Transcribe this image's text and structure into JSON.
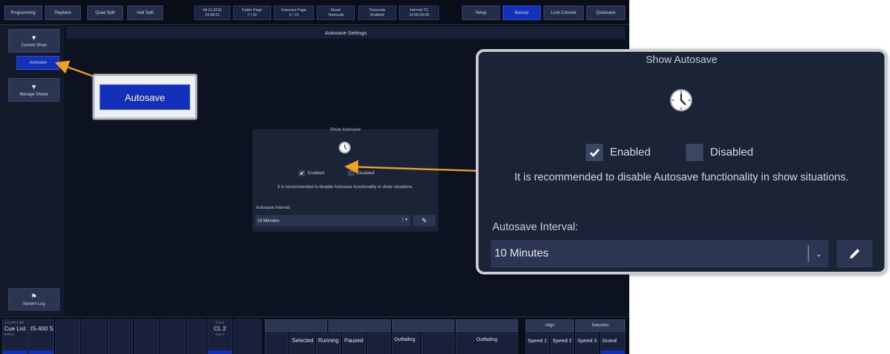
{
  "topbar": {
    "tabs": [
      "Programming",
      "Playback",
      "Quad Split",
      "Half Split"
    ],
    "datetime": {
      "date": "04.11.2016",
      "time": "19:48:21"
    },
    "fader_page": {
      "label": "Fader Page",
      "value": "7 / 10"
    },
    "executor_page": {
      "label": "Executor Page",
      "value": "2 / 10"
    },
    "reset_timecode": {
      "label": "Reset",
      "value": "Timecode"
    },
    "timecode": {
      "label": "Timecode",
      "value": "Enabled"
    },
    "internal_tc": {
      "label": "Internal TC",
      "value": "19:00:00:00"
    },
    "right_buttons": [
      "Setup",
      "Backup",
      "Lock Console",
      "Quicksave"
    ]
  },
  "sidebar": {
    "current_show": "Current Show",
    "autosave": "Autosave",
    "manage_shows": "Manage Shows",
    "system_log": "System Log"
  },
  "main": {
    "title": "Autosave Settings",
    "panel": {
      "title": "Show Autosave",
      "enabled_label": "Enabled",
      "disabled_label": "Disabled",
      "enabled_checked": true,
      "note": "It is recommended to disable Autosave functionality in show situations.",
      "interval_label": "Autosave Interval:",
      "interval_value": "10 Minutes"
    }
  },
  "callout": {
    "button_label": "Autosave"
  },
  "zoom": {
    "title": "Show Autosave",
    "enabled_label": "Enabled",
    "disabled_label": "Disabled",
    "note": "It is recommended to disable Autosave functionality in show situations.",
    "interval_label": "Autosave Interval:",
    "interval_value": "10 Minutes"
  },
  "bottom": {
    "cell1": {
      "head": "1 CLIFR 2 MR",
      "main": "Cue List",
      "sub": "INTRO"
    },
    "cell2": {
      "main": "IS-400 S"
    },
    "cell3": {
      "head": "9 CL2",
      "main": "CL 2",
      "sub": "Cue 1"
    },
    "playback_items": [
      "Selected",
      "Running",
      "Paused",
      "Outfading"
    ],
    "right_header": [
      "Align",
      "Selection"
    ],
    "right_items": [
      "Speed 1",
      "Speed 2",
      "Speed 3",
      "Grand"
    ]
  },
  "colors": {
    "accent_blue": "#1330b8",
    "arrow_orange": "#f0a020",
    "panel_bg": "#1b2337"
  }
}
